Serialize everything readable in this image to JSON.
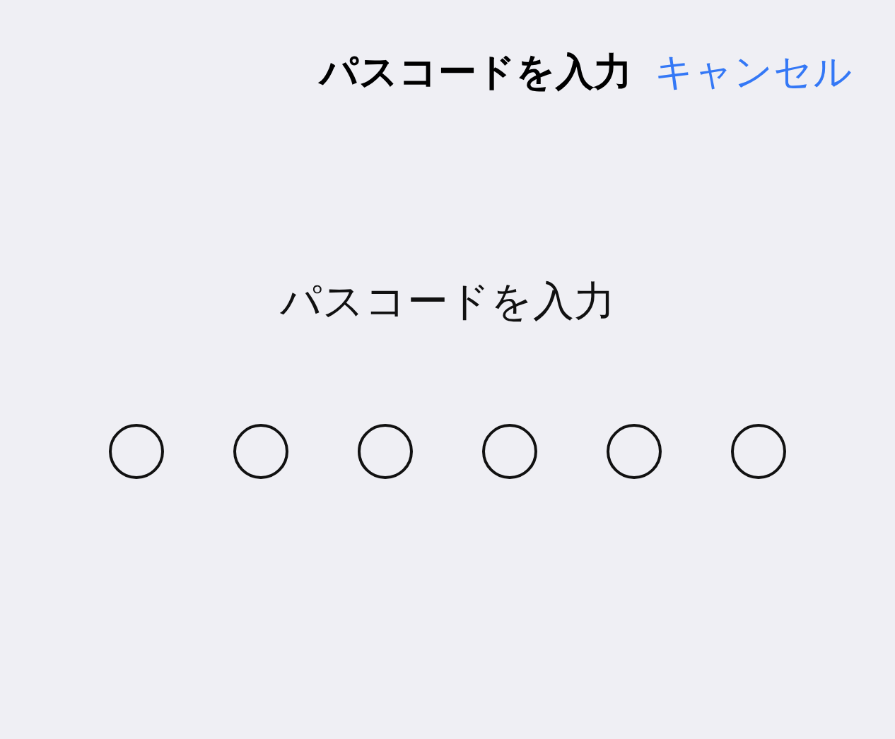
{
  "header": {
    "title": "パスコードを入力",
    "cancel": "キャンセル"
  },
  "prompt": "パスコードを入力",
  "dots": [
    {
      "filled": false
    },
    {
      "filled": false
    },
    {
      "filled": false
    },
    {
      "filled": false
    },
    {
      "filled": false
    },
    {
      "filled": false
    }
  ]
}
